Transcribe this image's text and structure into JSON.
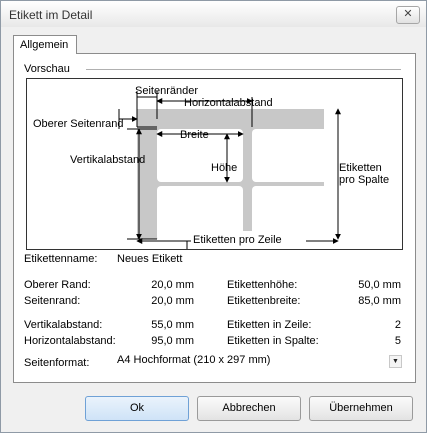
{
  "window": {
    "title": "Etikett im Detail",
    "close_glyph": "✕"
  },
  "tabs": [
    {
      "label": "Allgemein"
    }
  ],
  "preview": {
    "section_title": "Vorschau",
    "labels": {
      "seitenraender": "Seitenränder",
      "horizontalabstand": "Horizontalabstand",
      "oberer_seitenrand": "Oberer Seitenrand",
      "breite": "Breite",
      "vertikalabstand": "Vertikalabstand",
      "hoehe": "Höhe",
      "etiketten_pro_spalte_1": "Etiketten",
      "etiketten_pro_spalte_2": "pro Spalte",
      "etiketten_pro_zeile": "Etiketten pro Zeile"
    }
  },
  "fields": {
    "etikettenname": {
      "label": "Etikettenname:",
      "value": "Neues Etikett"
    },
    "oberer_rand": {
      "label": "Oberer Rand:",
      "value": "20,0 mm"
    },
    "seitenrand": {
      "label": "Seitenrand:",
      "value": "20,0 mm"
    },
    "vertikalabstand": {
      "label": "Vertikalabstand:",
      "value": "55,0 mm"
    },
    "horizontalabstand": {
      "label": "Horizontalabstand:",
      "value": "95,0 mm"
    },
    "etikettenhoehe": {
      "label": "Etikettenhöhe:",
      "value": "50,0 mm"
    },
    "etikettenbreite": {
      "label": "Etikettenbreite:",
      "value": "85,0 mm"
    },
    "etiketten_in_zeile": {
      "label": "Etiketten in Zeile:",
      "value": "2"
    },
    "etiketten_in_spalte": {
      "label": "Etiketten in Spalte:",
      "value": "5"
    },
    "seitenformat": {
      "label": "Seitenformat:",
      "value": "A4 Hochformat (210 x 297 mm)"
    }
  },
  "buttons": {
    "ok": "Ok",
    "abbrechen": "Abbrechen",
    "uebernehmen": "Übernehmen"
  }
}
